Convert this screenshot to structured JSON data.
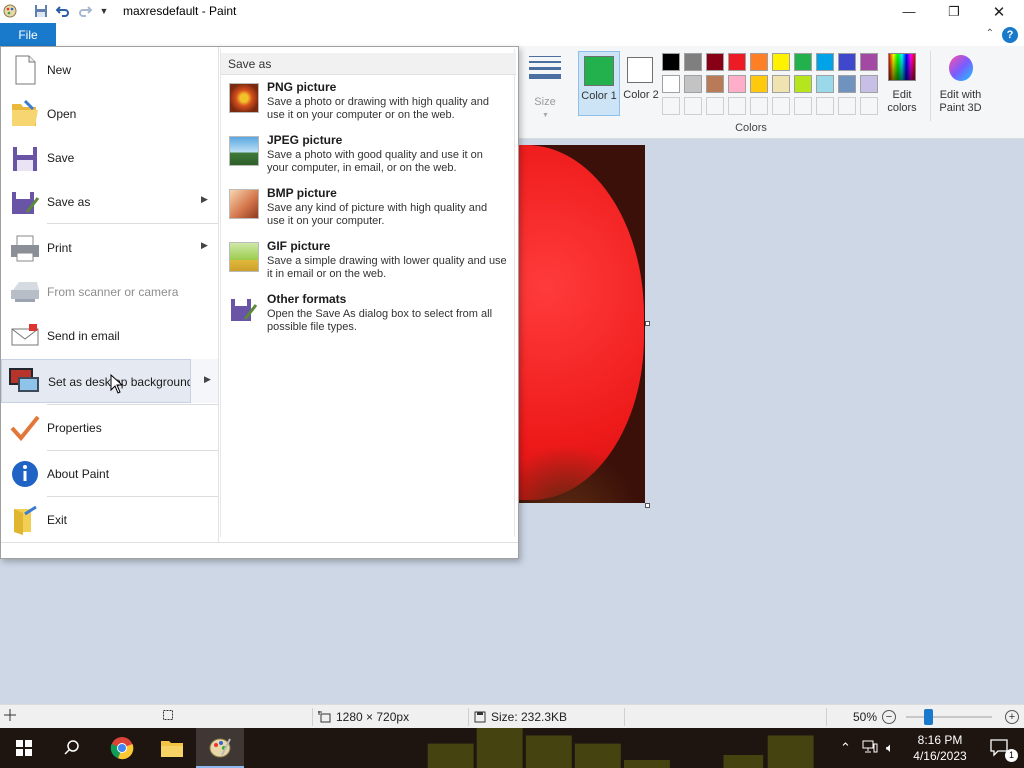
{
  "window": {
    "title": "maxresdefault - Paint",
    "minimize_glyph": "—",
    "maximize_glyph": "❐",
    "close_glyph": "✕"
  },
  "ribbon": {
    "file_tab": "File",
    "help_glyph": "?",
    "collapse_glyph": "⌃",
    "size_label": "Size",
    "color1_label": "Color 1",
    "color1_value": "#22b14c",
    "color2_label": "Color 2",
    "color2_value": "#ffffff",
    "colors_group_label": "Colors",
    "edit_colors_label": "Edit colors",
    "paint3d_label": "Edit with Paint 3D",
    "palette": [
      "#000000",
      "#7f7f7f",
      "#880015",
      "#ed1c24",
      "#ff7f27",
      "#fff200",
      "#22b14c",
      "#00a2e8",
      "#3f48cc",
      "#a349a4",
      "#ffffff",
      "#c3c3c3",
      "#b97a57",
      "#ffaec9",
      "#ffc90e",
      "#efe4b0",
      "#b5e61d",
      "#99d9ea",
      "#7092be",
      "#c8bfe7"
    ]
  },
  "file_menu": {
    "items": [
      {
        "label": "New",
        "icon": "new-document-icon"
      },
      {
        "label": "Open",
        "icon": "open-folder-icon"
      },
      {
        "label": "Save",
        "icon": "save-disk-icon"
      },
      {
        "label": "Save as",
        "icon": "save-as-icon"
      },
      {
        "label": "Print",
        "icon": "printer-icon"
      },
      {
        "label": "From scanner or camera",
        "icon": "scanner-icon"
      },
      {
        "label": "Send in email",
        "icon": "email-icon"
      },
      {
        "label": "Set as desktop background",
        "icon": "desktop-background-icon"
      },
      {
        "label": "Properties",
        "icon": "checkmark-icon"
      },
      {
        "label": "About Paint",
        "icon": "info-icon"
      },
      {
        "label": "Exit",
        "icon": "exit-icon"
      }
    ],
    "save_as_panel": {
      "header": "Save as",
      "options": [
        {
          "title": "PNG picture",
          "desc": "Save a photo or drawing with high quality and use it on your computer or on the web."
        },
        {
          "title": "JPEG picture",
          "desc": "Save a photo with good quality and use it on your computer, in email, or on the web."
        },
        {
          "title": "BMP picture",
          "desc": "Save any kind of picture with high quality and use it on your computer."
        },
        {
          "title": "GIF picture",
          "desc": "Save a simple drawing with lower quality and use it in email or on the web."
        },
        {
          "title": "Other formats",
          "desc": "Open the Save As dialog box to select from all possible file types."
        }
      ]
    }
  },
  "statusbar": {
    "dimensions": "1280 × 720px",
    "size": "Size: 232.3KB",
    "zoom": "50%"
  },
  "taskbar": {
    "time": "8:16 PM",
    "date": "4/16/2023",
    "notification_count": "1"
  }
}
